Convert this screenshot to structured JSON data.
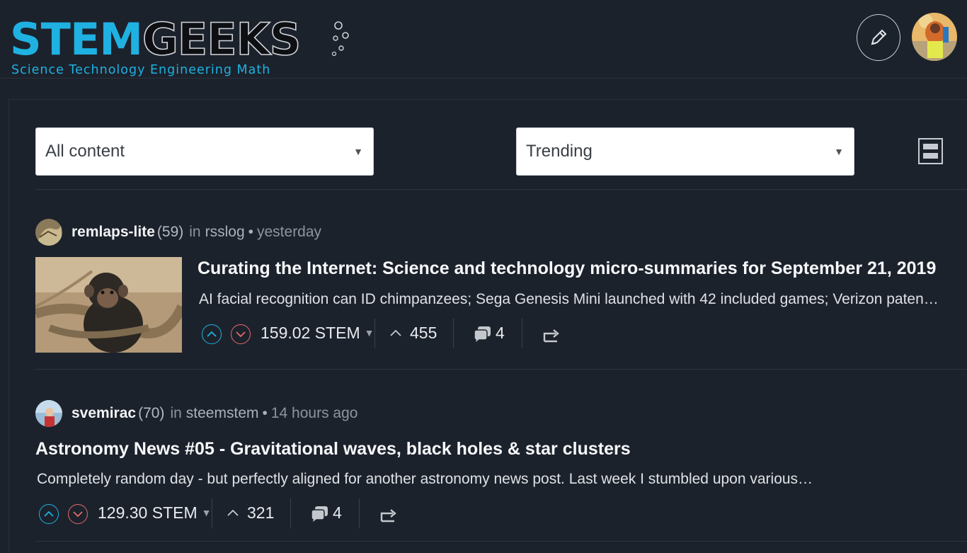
{
  "brand": {
    "name_part1": "STEM",
    "name_part2": "GEEKS",
    "tagline": "Science Technology Engineering Math",
    "primary_color": "#1fb1e2"
  },
  "header": {
    "edit_icon": "pencil-icon",
    "avatar": "user-avatar"
  },
  "filters": {
    "content": {
      "selected": "All content"
    },
    "sort": {
      "selected": "Trending"
    },
    "layout_toggle_icon": "layout-list-icon"
  },
  "posts": [
    {
      "author": "remlaps-lite",
      "reputation": "(59)",
      "in_label": "in",
      "community": "rsslog",
      "separator": "•",
      "time": "yesterday",
      "title": "Curating the Internet: Science and technology micro-summaries for September 21, 2019",
      "summary": "AI facial recognition can ID chimpanzees; Sega Genesis Mini launched with 42 included games; Verizon paten…",
      "has_thumbnail": true,
      "payout": "159.02 STEM",
      "votes": "455",
      "comments": "4"
    },
    {
      "author": "svemirac",
      "reputation": "(70)",
      "in_label": "in",
      "community": "steemstem",
      "separator": "•",
      "time": "14 hours ago",
      "title": "Astronomy News #05 - Gravitational waves, black holes & star clusters",
      "summary": "Completely random day - but perfectly aligned for another astronomy news post. Last week I stumbled upon various…",
      "has_thumbnail": false,
      "payout": "129.30 STEM",
      "votes": "321",
      "comments": "4"
    }
  ],
  "colors": {
    "background": "#1c222c",
    "upvote": "#1fb1e2",
    "downvote": "#e26a6a"
  }
}
